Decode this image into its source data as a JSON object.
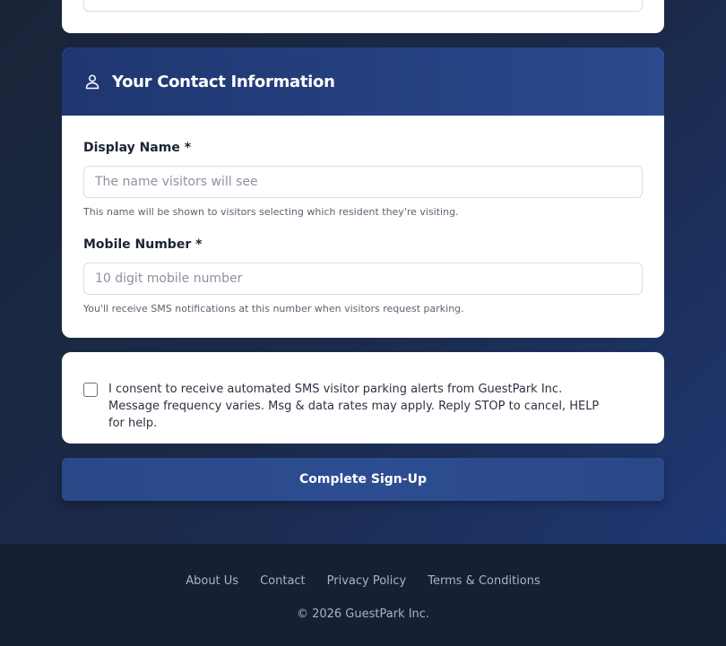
{
  "contact_section": {
    "title": "Your Contact Information",
    "display_name": {
      "label": "Display Name *",
      "placeholder": "The name visitors will see",
      "value": "",
      "help": "This name will be shown to visitors selecting which resident they're visiting."
    },
    "mobile_number": {
      "label": "Mobile Number *",
      "placeholder": "10 digit mobile number",
      "value": "",
      "help": "You'll receive SMS notifications at this number when visitors request parking."
    }
  },
  "consent": {
    "checked": false,
    "text": "I consent to receive automated SMS visitor parking alerts from GuestPark Inc. Message frequency varies. Msg & data rates may apply. Reply STOP to cancel, HELP for help."
  },
  "submit": {
    "label": "Complete Sign-Up"
  },
  "footer": {
    "links": [
      "About Us",
      "Contact",
      "Privacy Policy",
      "Terms & Conditions"
    ],
    "copyright": "© 2026 GuestPark Inc."
  },
  "colors": {
    "header_blue": "#1f3670",
    "button_blue": "#2a4888",
    "footer_bg": "#172033"
  },
  "icons": {
    "contact_header": "user-icon"
  }
}
